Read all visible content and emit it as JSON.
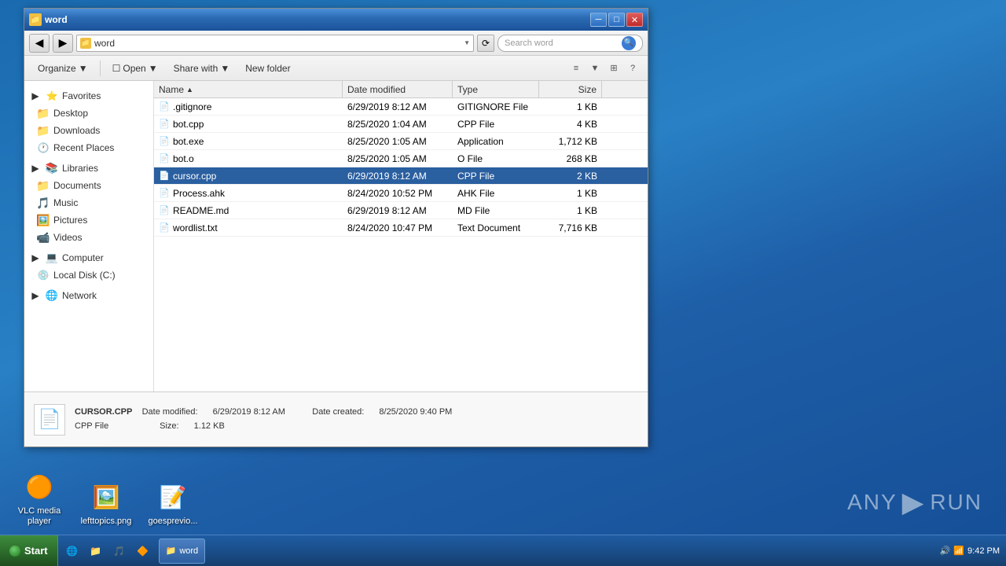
{
  "window": {
    "title": "word",
    "icon": "📁"
  },
  "titlebar": {
    "min_label": "─",
    "max_label": "□",
    "close_label": "✕"
  },
  "nav": {
    "back_label": "◀",
    "forward_label": "▶",
    "address": "word",
    "address_icon": "📁",
    "refresh_label": "⟳",
    "search_placeholder": "Search word"
  },
  "toolbar": {
    "organize_label": "Organize",
    "open_label": "Open",
    "share_label": "Share with",
    "new_folder_label": "New folder"
  },
  "sidebar": {
    "favorites_label": "Favorites",
    "desktop_label": "Desktop",
    "downloads_label": "Downloads",
    "recent_label": "Recent Places",
    "libraries_label": "Libraries",
    "documents_label": "Documents",
    "music_label": "Music",
    "pictures_label": "Pictures",
    "videos_label": "Videos",
    "computer_label": "Computer",
    "local_disk_label": "Local Disk (C:)",
    "network_label": "Network"
  },
  "columns": {
    "name": "Name",
    "date_modified": "Date modified",
    "type": "Type",
    "size": "Size"
  },
  "files": [
    {
      "name": ".gitignore",
      "date": "6/29/2019 8:12 AM",
      "type": "GITIGNORE File",
      "size": "1 KB",
      "icon": "📄",
      "selected": false
    },
    {
      "name": "bot.cpp",
      "date": "8/25/2020 1:04 AM",
      "type": "CPP File",
      "size": "4 KB",
      "icon": "📄",
      "selected": false
    },
    {
      "name": "bot.exe",
      "date": "8/25/2020 1:05 AM",
      "type": "Application",
      "size": "1,712 KB",
      "icon": "⚙️",
      "selected": false
    },
    {
      "name": "bot.o",
      "date": "8/25/2020 1:05 AM",
      "type": "O File",
      "size": "268 KB",
      "icon": "📄",
      "selected": false
    },
    {
      "name": "cursor.cpp",
      "date": "6/29/2019 8:12 AM",
      "type": "CPP File",
      "size": "2 KB",
      "icon": "📄",
      "selected": true
    },
    {
      "name": "Process.ahk",
      "date": "8/24/2020 10:52 PM",
      "type": "AHK File",
      "size": "1 KB",
      "icon": "📄",
      "selected": false
    },
    {
      "name": "README.md",
      "date": "6/29/2019 8:12 AM",
      "type": "MD File",
      "size": "1 KB",
      "icon": "📄",
      "selected": false
    },
    {
      "name": "wordlist.txt",
      "date": "8/24/2020 10:47 PM",
      "type": "Text Document",
      "size": "7,716 KB",
      "icon": "📄",
      "selected": false
    }
  ],
  "status": {
    "filename": "CURSOR.CPP",
    "filetype": "CPP File",
    "date_modified_label": "Date modified:",
    "date_modified_value": "6/29/2019 8:12 AM",
    "date_created_label": "Date created:",
    "date_created_value": "8/25/2020 9:40 PM",
    "size_label": "Size:",
    "size_value": "1.12 KB"
  },
  "taskbar": {
    "start_label": "Start",
    "time": "9:42 PM",
    "taskbar_items": [
      {
        "label": "IE",
        "icon": "🌐"
      },
      {
        "label": "Folder",
        "icon": "📁"
      },
      {
        "label": "Media",
        "icon": "🎵"
      },
      {
        "label": "App",
        "icon": "🔶"
      }
    ]
  },
  "desktop_icons": [
    {
      "label": "VLC media\nplayer",
      "icon": "🟠"
    },
    {
      "label": "lefttopics.png",
      "icon": "🖼️"
    },
    {
      "label": "goesprevio...",
      "icon": "📝"
    }
  ],
  "anyrun": {
    "label": "ANY▶RUN"
  }
}
